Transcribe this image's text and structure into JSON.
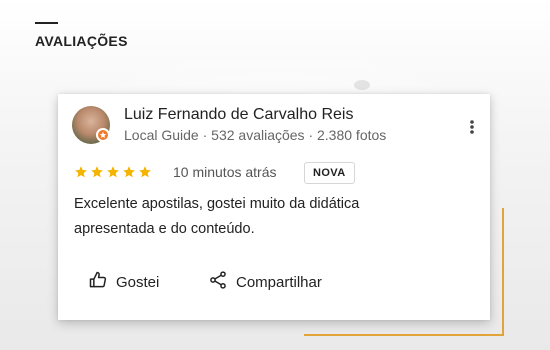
{
  "section": {
    "title": "AVALIAÇÕES"
  },
  "review": {
    "author_name": "Luiz Fernando de Carvalho Reis",
    "author_meta": "Local Guide · 532 avaliações · 2.380 fotos",
    "rating": 5,
    "rating_max": 5,
    "time": "10 minutos atrás",
    "badge": "NOVA",
    "text": "Excelente apostilas, gostei muito da didática apresentada e do conteúdo.",
    "actions": {
      "like_label": "Gostei",
      "share_label": "Compartilhar"
    }
  },
  "colors": {
    "star": "#f5b400",
    "accent": "#e0a43a",
    "guide_badge": "#f07a2c"
  },
  "icons": {
    "menu": "more-vert-icon",
    "like": "thumbs-up-icon",
    "share": "share-icon"
  }
}
